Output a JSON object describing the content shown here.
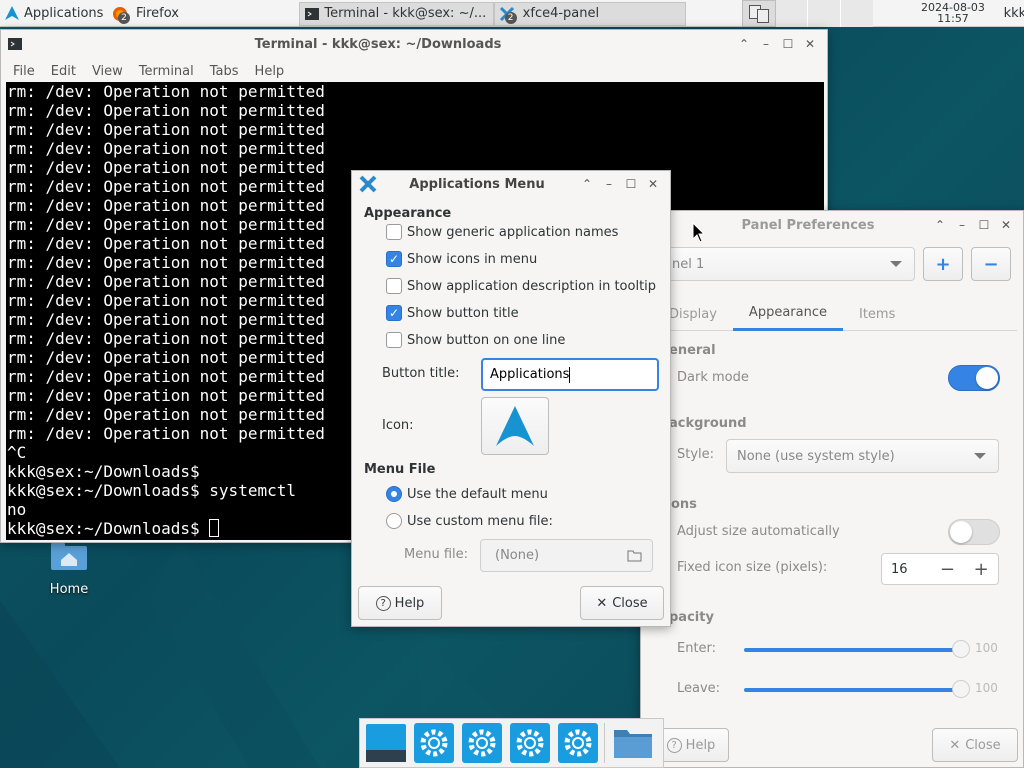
{
  "top_panel": {
    "apps_label": "Applications",
    "apps_suffix": "☰",
    "tasks": [
      {
        "label": "Firefox",
        "badge": "2"
      },
      {
        "label": "Terminal - kkk@sex: ~/..."
      },
      {
        "label": "xfce4-panel",
        "badge": "2"
      }
    ],
    "clock_date": "2024-08-03",
    "clock_time": "11:57",
    "user": "kkk"
  },
  "terminal": {
    "title": "Terminal - kkk@sex: ~/Downloads",
    "menu": [
      "File",
      "Edit",
      "View",
      "Terminal",
      "Tabs",
      "Help"
    ],
    "lines": [
      "rm: /dev: Operation not permitted",
      "rm: /dev: Operation not permitted",
      "rm: /dev: Operation not permitted",
      "rm: /dev: Operation not permitted",
      "rm: /dev: Operation not permitted",
      "rm: /dev: Operation not permitted",
      "rm: /dev: Operation not permitted",
      "rm: /dev: Operation not permitted",
      "rm: /dev: Operation not permitted",
      "rm: /dev: Operation not permitted",
      "rm: /dev: Operation not permitted",
      "rm: /dev: Operation not permitted",
      "rm: /dev: Operation not permitted",
      "rm: /dev: Operation not permitted",
      "rm: /dev: Operation not permitted",
      "rm: /dev: Operation not permitted",
      "rm: /dev: Operation not permitted",
      "rm: /dev: Operation not permitted",
      "rm: /dev: Operation not permitted",
      "^C",
      "kkk@sex:~/Downloads$",
      "kkk@sex:~/Downloads$ systemctl",
      "no",
      "kkk@sex:~/Downloads$ "
    ]
  },
  "apps_menu": {
    "title": "Applications Menu",
    "appearance_heading": "Appearance",
    "options": [
      {
        "label": "Show generic application names",
        "checked": false
      },
      {
        "label": "Show icons in menu",
        "checked": true
      },
      {
        "label": "Show application description in tooltip",
        "checked": false
      },
      {
        "label": "Show button title",
        "checked": true
      },
      {
        "label": "Show button on one line",
        "checked": false
      }
    ],
    "button_title_label": "Button title:",
    "button_title_value": "Applications",
    "icon_label": "Icon:",
    "menu_file_heading": "Menu File",
    "use_default_label": "Use the default menu",
    "use_custom_label": "Use custom menu file:",
    "menu_file_label": "Menu file:",
    "menu_file_value": "(None)",
    "help_label": "Help",
    "close_label": "Close"
  },
  "panel_prefs": {
    "title": "Panel Preferences",
    "panel_select": "anel 1",
    "add_label": "+",
    "remove_label": "−",
    "tabs": [
      "Display",
      "Appearance",
      "Items"
    ],
    "general_heading": "eneral",
    "dark_mode_label": "Dark mode",
    "background_heading": "ackground",
    "style_label": "Style:",
    "style_value": "None (use system style)",
    "icons_heading": "ons",
    "adjust_size_label": "Adjust size automatically",
    "fixed_size_label": "Fixed icon size (pixels):",
    "fixed_size_value": "16",
    "opacity_heading": "pacity",
    "enter_label": "Enter:",
    "enter_value": "100",
    "leave_label": "Leave:",
    "leave_value": "100",
    "help_label": "Help",
    "close_label": "Close"
  },
  "desktop": {
    "home_label": "Home"
  },
  "colors": {
    "accent": "#3584e4",
    "desktop": "#0f5a6a"
  }
}
